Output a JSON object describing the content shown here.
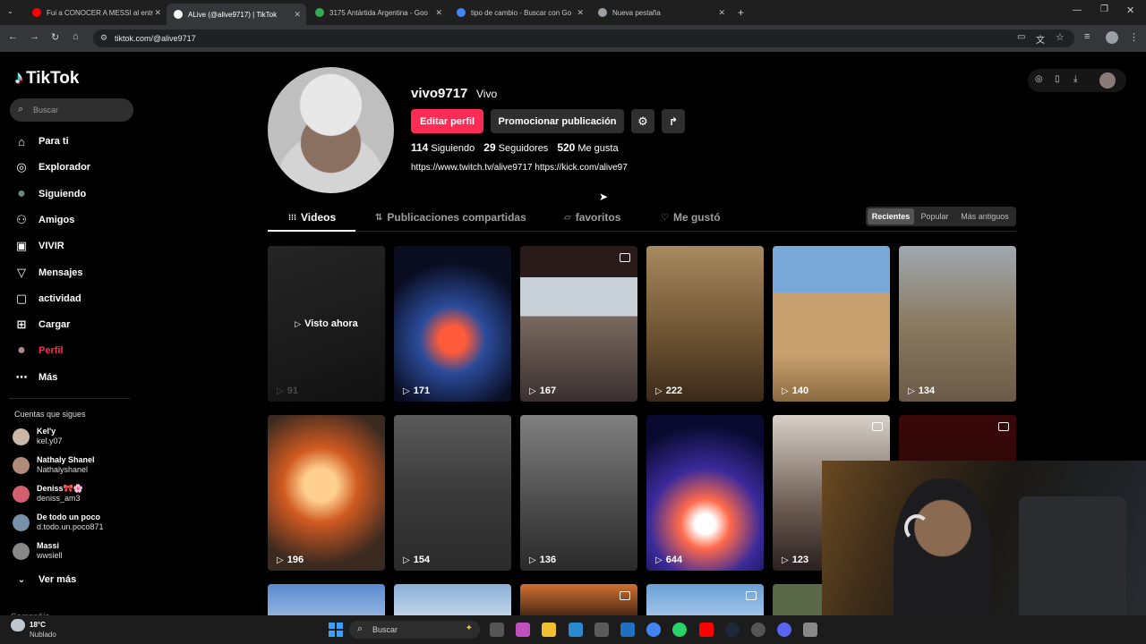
{
  "browser": {
    "tabs": [
      {
        "title": "Fui a CONOCER A MESSI al entr",
        "color": "#ff0000"
      },
      {
        "title": "ALive (@alive9717) | TikTok",
        "color": "#ffffff"
      },
      {
        "title": "3175 Antártida Argentina - Goo",
        "color": "#34a853"
      },
      {
        "title": "tipo de cambio - Buscar con Go",
        "color": "#4285f4"
      },
      {
        "title": "Nueva pestaña",
        "color": "#9aa0a6"
      }
    ],
    "url": "tiktok.com/@alive9717"
  },
  "tiktok": {
    "logo": "TikTok",
    "search_placeholder": "Buscar",
    "nav": [
      {
        "label": "Para ti",
        "icon": "home-icon",
        "glyph": "⌂"
      },
      {
        "label": "Explorador",
        "icon": "compass-icon",
        "glyph": "◎"
      },
      {
        "label": "Siguiendo",
        "icon": "following-avatar-icon",
        "glyph": "●"
      },
      {
        "label": "Amigos",
        "icon": "friends-icon",
        "glyph": "⚇"
      },
      {
        "label": "VIVIR",
        "icon": "live-icon",
        "glyph": "▣"
      },
      {
        "label": "Mensajes",
        "icon": "messages-icon",
        "glyph": "▽"
      },
      {
        "label": "actividad",
        "icon": "activity-icon",
        "glyph": "▢"
      },
      {
        "label": "Cargar",
        "icon": "upload-icon",
        "glyph": "⊞"
      },
      {
        "label": "Perfil",
        "icon": "profile-avatar-icon",
        "glyph": "●"
      },
      {
        "label": "Más",
        "icon": "more-icon",
        "glyph": "⋯"
      }
    ],
    "following_header": "Cuentas que sigues",
    "following": [
      {
        "name": "Kel'y",
        "handle": "kel.y07",
        "color": "#c9b8a8"
      },
      {
        "name": "Nathaly Shanel",
        "handle": "Nathalyshanel",
        "color": "#b08a7a"
      },
      {
        "name": "Deniss🎀🌸",
        "handle": "deniss_am3",
        "color": "#d06070"
      },
      {
        "name": "De todo un poco",
        "handle": "d.todo.un.poco871",
        "color": "#7890a8"
      },
      {
        "name": "Massi",
        "handle": "wwsiell",
        "color": "#888888"
      }
    ],
    "see_more": "Ver más",
    "bottom_partial": "Compañía"
  },
  "profile": {
    "username": "vivo9717",
    "nickname": "Vivo",
    "edit_button": "Editar perfil",
    "promote_button": "Promocionar publicación",
    "following_count": "114",
    "following_label": "Siguiendo",
    "followers_count": "29",
    "followers_label": "Seguidores",
    "likes_count": "520",
    "likes_label": "Me gusta",
    "bio": "https://www.twitch.tv/alive9717 https://kick.com/alive97",
    "tabs": [
      "Videos",
      "Publicaciones compartidas",
      "favoritos",
      "Me gustó"
    ],
    "sort": [
      "Recientes",
      "Popular",
      "Más antiguos"
    ]
  },
  "videos": [
    {
      "views": "91",
      "overlay": "Visto ahora",
      "bg": "linear-gradient(160deg,#3a3a3a,#1c1c1c)"
    },
    {
      "views": "171",
      "bg": "radial-gradient(circle at 50% 60%,#ff5a3a 0 12%,#2b4c9a 30%,#0a0c20 70%)"
    },
    {
      "views": "167",
      "photo": true,
      "bg": "linear-gradient(180deg,#2a1a1a 0 20%,#c8d0d8 20% 45%,#7a6a60 45%,#3a3030 100%)"
    },
    {
      "views": "222",
      "bg": "linear-gradient(180deg,#a88a60,#6a5030 60%,#3a2a1a)"
    },
    {
      "views": "140",
      "bg": "linear-gradient(180deg,#7aa8d8 0 30%,#c8a070 30% 70%,#8a6a40)"
    },
    {
      "views": "134",
      "bg": "linear-gradient(180deg,#a0a8b0,#8a7a60 50%,#6a5a48)"
    },
    {
      "views": "196",
      "bg": "radial-gradient(circle at 45% 45%,#ffd090 0 15%,#d05a20 35%,#3a2a20 75%)"
    },
    {
      "views": "154",
      "bg": "linear-gradient(180deg,#5a5a5a,#3a3a3a 50%,#2a2a2a)"
    },
    {
      "views": "136",
      "bg": "linear-gradient(180deg,#808080,#4a4a4a 60%,#2a2a2a)"
    },
    {
      "views": "644",
      "bg": "radial-gradient(circle at 50% 70%,#ffffff 0 8%,#ff6a4a 20%,#3a2a9a 45%,#0a0a30 80%)"
    },
    {
      "views": "123",
      "photo": true,
      "bg": "linear-gradient(180deg,#d8d0c8,#6a5a50 60%,#2a2020)"
    },
    {
      "views": "",
      "photo": true,
      "bg": "linear-gradient(180deg,#3a0808,#1a0606)"
    }
  ],
  "taskbar": {
    "weather_temp": "18°C",
    "weather_desc": "Nublado",
    "search_placeholder": "Buscar"
  }
}
